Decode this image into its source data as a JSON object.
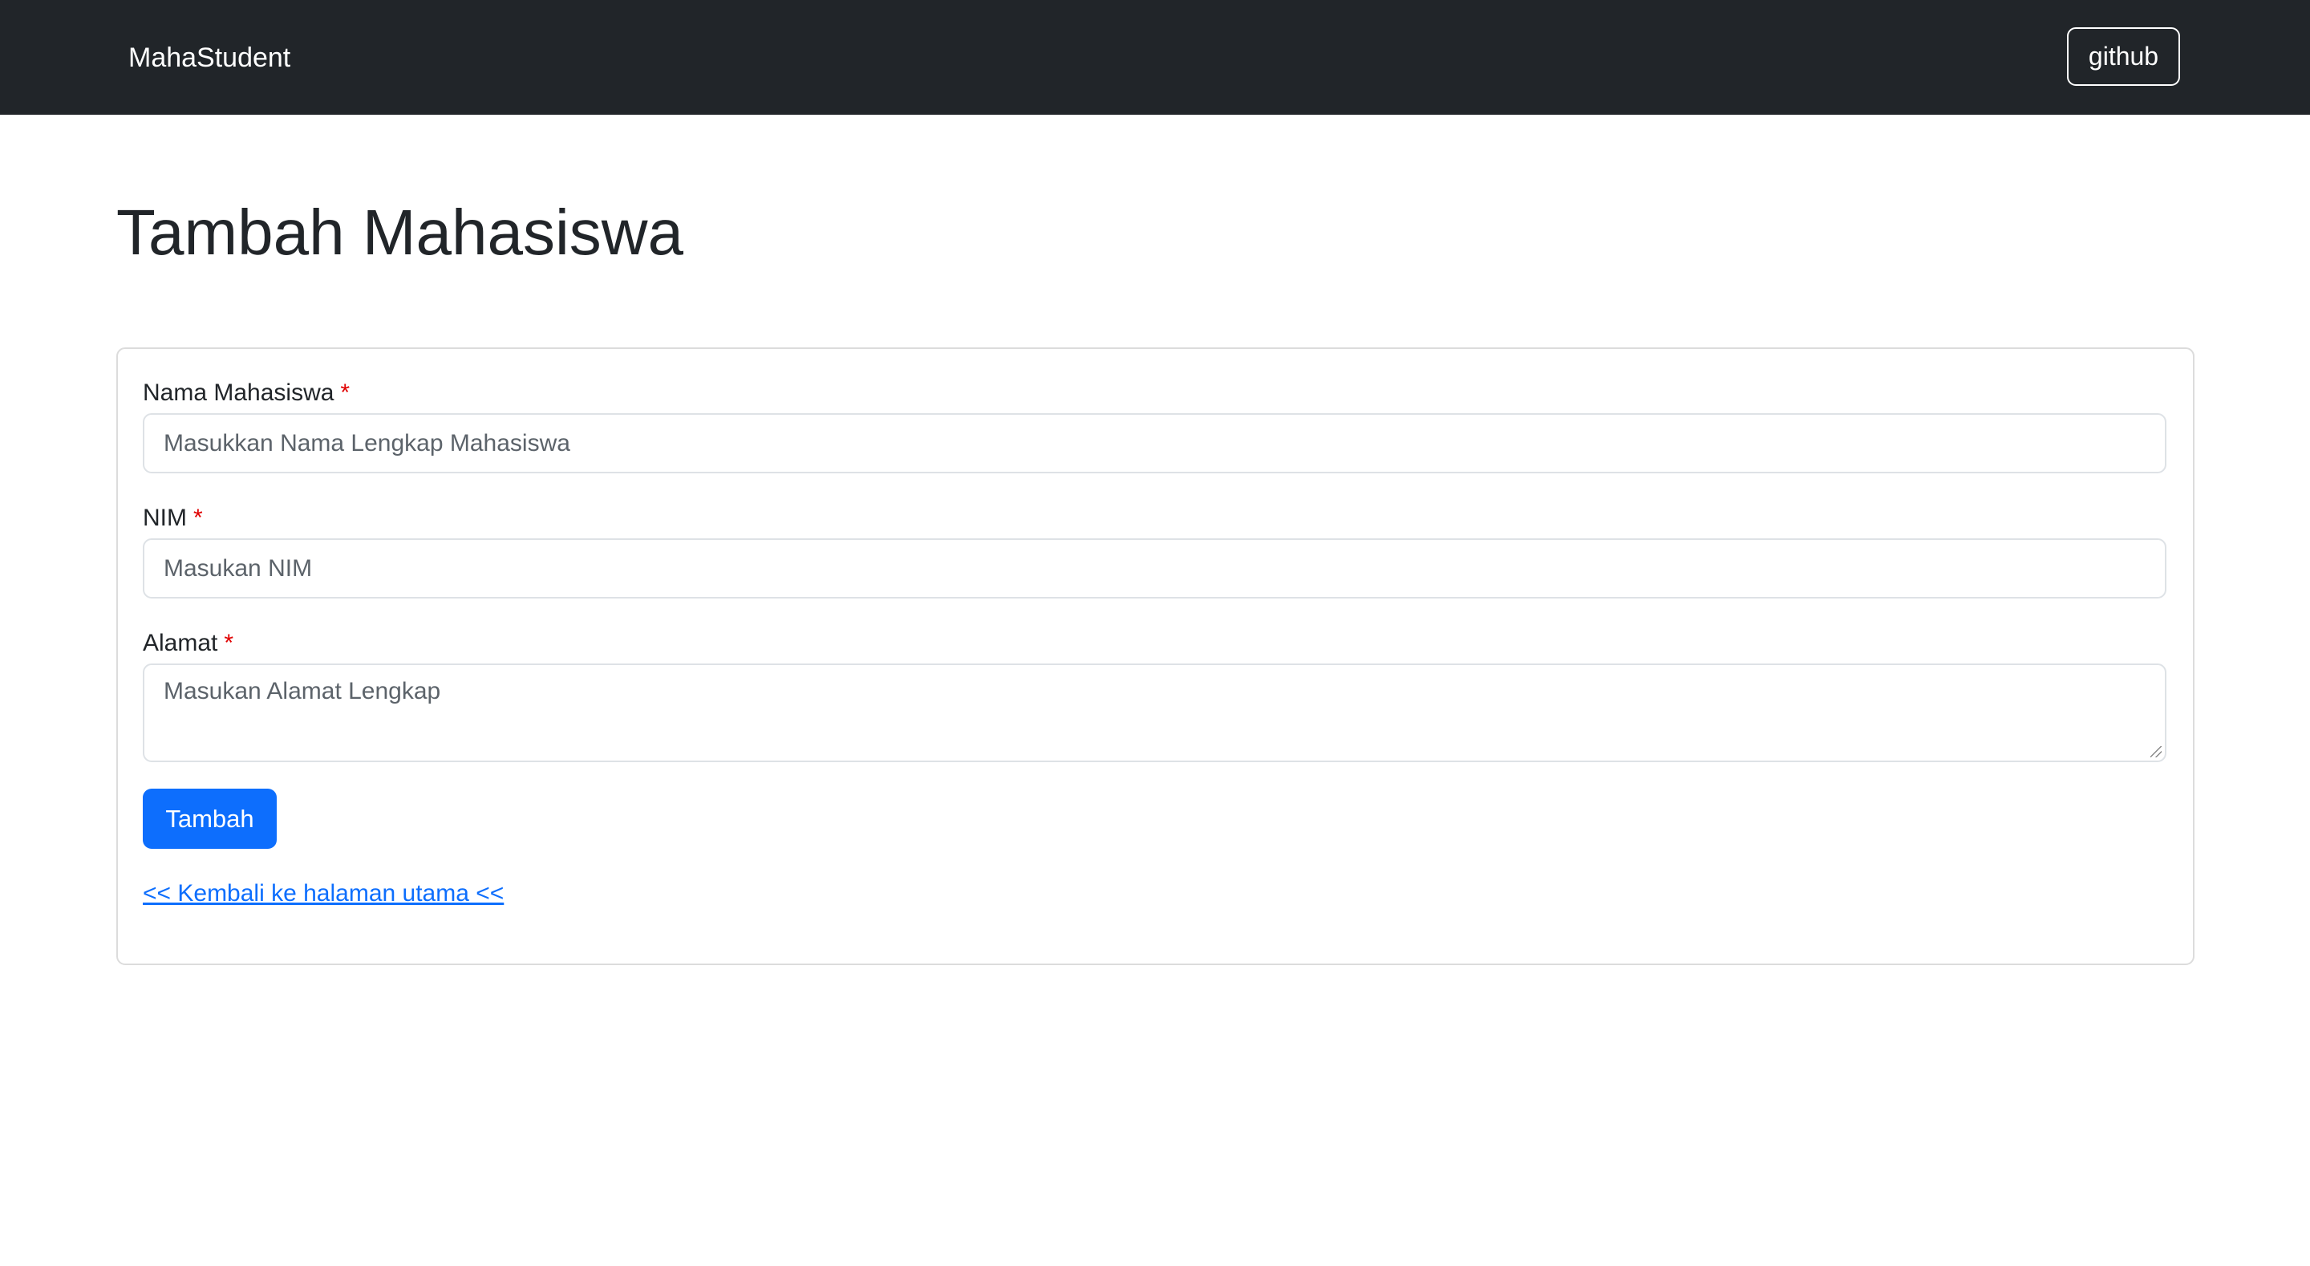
{
  "navbar": {
    "brand": "MahaStudent",
    "github_label": "github"
  },
  "page_title": "Tambah Mahasiswa",
  "form": {
    "required_mark": "*",
    "nama": {
      "label": "Nama Mahasiswa",
      "placeholder": "Masukkan Nama Lengkap Mahasiswa"
    },
    "nim": {
      "label": "NIM",
      "placeholder": "Masukan NIM"
    },
    "alamat": {
      "label": "Alamat",
      "placeholder": "Masukan Alamat Lengkap"
    },
    "submit_label": "Tambah",
    "back_link": "<< Kembali ke halaman utama <<"
  },
  "colors": {
    "navbar_bg": "#212529",
    "primary": "#0d6efd",
    "required": "#e00000"
  }
}
